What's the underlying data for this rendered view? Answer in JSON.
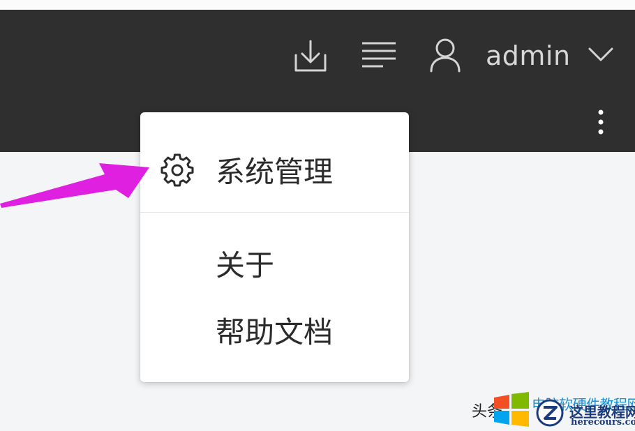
{
  "header": {
    "username": "admin",
    "icons": {
      "download": "download-icon",
      "list": "list-icon",
      "user": "user-icon",
      "chevron": "chevron-down-icon",
      "more": "more-vertical-icon"
    }
  },
  "menu": {
    "items": [
      {
        "label": "系统管理",
        "icon": "gear-icon"
      },
      {
        "label": "关于"
      },
      {
        "label": "帮助文档"
      }
    ]
  },
  "colors": {
    "header_bg": "#2f2f2f",
    "header_text": "#d8d8d8",
    "menu_text": "#2b2b2b",
    "annotation_arrow": "#e020e0",
    "content_bg": "#f4f5f7"
  },
  "watermark": {
    "prefix": "头条",
    "blue_text": "电脑软硬件教程网",
    "site_cn": "这里教程网",
    "site_en": "herecours.com"
  }
}
